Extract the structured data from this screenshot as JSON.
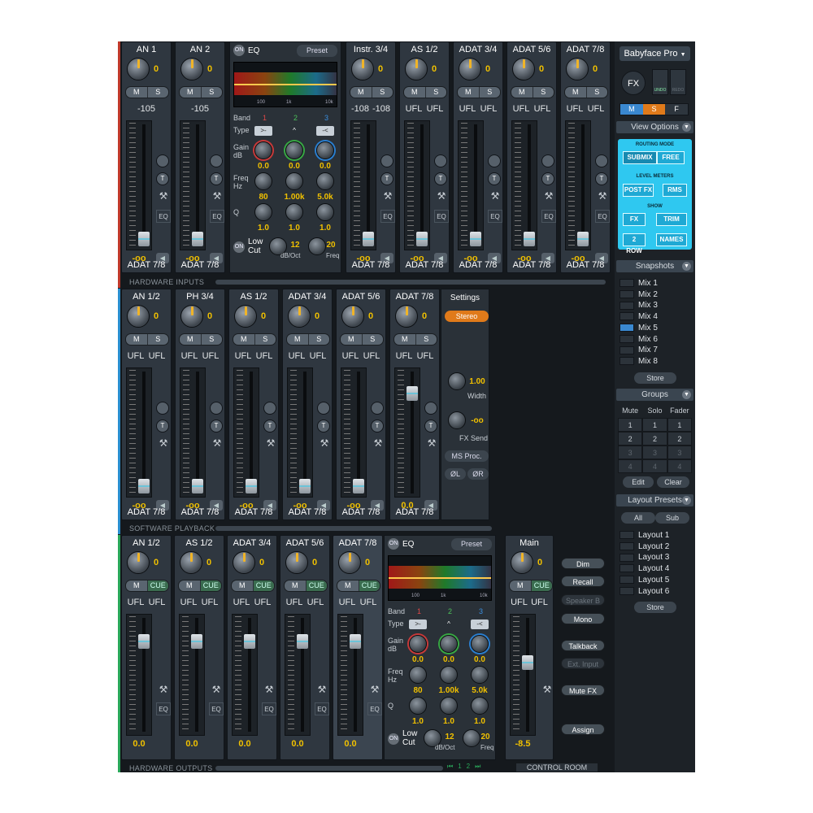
{
  "inputs": {
    "channels": [
      {
        "name": "AN 1",
        "gain": "0",
        "level": "-105",
        "route": "ADAT 7/8",
        "fader": "-oo"
      },
      {
        "name": "AN 2",
        "gain": "0",
        "level": "-105",
        "route": "ADAT 7/8",
        "fader": "-oo"
      },
      {
        "name": "Instr. 3/4",
        "gain": "0",
        "level_l": "-108",
        "level_r": "-108",
        "route": "ADAT 7/8",
        "fader": "-oo"
      },
      {
        "name": "AS 1/2",
        "gain": "0",
        "level_l": "UFL",
        "level_r": "UFL",
        "route": "ADAT 7/8",
        "fader": "-oo"
      },
      {
        "name": "ADAT 3/4",
        "gain": "0",
        "level_l": "UFL",
        "level_r": "UFL",
        "route": "ADAT 7/8",
        "fader": "-oo"
      },
      {
        "name": "ADAT 5/6",
        "gain": "0",
        "level_l": "UFL",
        "level_r": "UFL",
        "route": "ADAT 7/8",
        "fader": "-oo"
      },
      {
        "name": "ADAT 7/8",
        "gain": "0",
        "level_l": "UFL",
        "level_r": "UFL",
        "route": "ADAT 7/8",
        "fader": "-oo"
      }
    ],
    "section_label": "HARDWARE INPUTS"
  },
  "eq": {
    "power": "ON",
    "title": "EQ",
    "preset": "Preset",
    "graph_labels": [
      "100",
      "1k",
      "10k"
    ],
    "band_label": "Band",
    "bands": [
      "1",
      "2",
      "3"
    ],
    "type_label": "Type",
    "types": [
      ">-",
      "^",
      "-<"
    ],
    "gain_label": "Gain",
    "gain_unit": "dB",
    "gain_values": [
      "0.0",
      "0.0",
      "0.0"
    ],
    "freq_label": "Freq",
    "freq_unit": "Hz",
    "freq_values": [
      "80",
      "1.00k",
      "5.0k"
    ],
    "q_label": "Q",
    "q_values": [
      "1.0",
      "1.0",
      "1.0"
    ],
    "lowcut_label": "Low Cut",
    "lowcut_slope": "12",
    "lowcut_slope_unit": "dB/Oct",
    "lowcut_freq": "20",
    "lowcut_freq_unit": "Freq"
  },
  "playback": {
    "channels": [
      {
        "name": "AN 1/2",
        "gain": "0",
        "route": "ADAT 7/8",
        "fader": "-oo"
      },
      {
        "name": "PH 3/4",
        "gain": "0",
        "route": "ADAT 7/8",
        "fader": "-oo"
      },
      {
        "name": "AS 1/2",
        "gain": "0",
        "route": "ADAT 7/8",
        "fader": "-oo"
      },
      {
        "name": "ADAT 3/4",
        "gain": "0",
        "route": "ADAT 7/8",
        "fader": "-oo"
      },
      {
        "name": "ADAT 5/6",
        "gain": "0",
        "route": "ADAT 7/8",
        "fader": "-oo"
      },
      {
        "name": "ADAT 7/8",
        "gain": "0",
        "route": "ADAT 7/8",
        "fader": "0.0"
      }
    ],
    "level_l": "UFL",
    "level_r": "UFL",
    "settings": {
      "title": "Settings",
      "mode": "Stereo",
      "width_value": "1.00",
      "width_label": "Width",
      "fxsend_value": "-oo",
      "fxsend_label": "FX Send",
      "ms_proc": "MS Proc.",
      "phase_l": "ØL",
      "phase_r": "ØR"
    },
    "section_label": "SOFTWARE PLAYBACK"
  },
  "outputs": {
    "channels": [
      {
        "name": "AN 1/2",
        "gain": "0",
        "fader": "0.0"
      },
      {
        "name": "AS 1/2",
        "gain": "0",
        "fader": "0.0"
      },
      {
        "name": "ADAT 3/4",
        "gain": "0",
        "fader": "0.0"
      },
      {
        "name": "ADAT 5/6",
        "gain": "0",
        "fader": "0.0"
      },
      {
        "name": "ADAT 7/8",
        "gain": "0",
        "fader": "0.0"
      }
    ],
    "level_l": "UFL",
    "level_r": "UFL",
    "mute_label": "M",
    "cue_label": "CUE",
    "main": {
      "name": "Main",
      "gain": "0",
      "fader": "-8.5"
    },
    "control_buttons": [
      "Dim",
      "Recall",
      "Speaker B",
      "Mono",
      "Talkback",
      "Ext. Input",
      "Mute FX",
      "Assign"
    ],
    "section_label": "HARDWARE OUTPUTS",
    "control_room_label": "CONTROL ROOM",
    "pages": [
      "1",
      "2"
    ]
  },
  "sidebar": {
    "device": "Babyface Pro",
    "fx_label": "FX",
    "undo": "UNDO",
    "redo": "REDO",
    "ms_buttons": [
      "M",
      "S",
      "F"
    ],
    "view_options": "View Options",
    "routing_mode_label": "ROUTING MODE",
    "submix": "SUBMIX",
    "free": "FREE",
    "level_meters_label": "LEVEL METERS",
    "post_fx": "POST FX",
    "rms": "RMS",
    "show_label": "SHOW",
    "fx": "FX",
    "trim": "TRIM",
    "two_row": "2 ROW",
    "names": "NAMES",
    "snapshots_label": "Snapshots",
    "snapshots": [
      "Mix 1",
      "Mix 2",
      "Mix 3",
      "Mix 4",
      "Mix 5",
      "Mix 6",
      "Mix 7",
      "Mix 8"
    ],
    "active_snapshot": 4,
    "store": "Store",
    "groups_label": "Groups",
    "group_headers": [
      "Mute",
      "Solo",
      "Fader"
    ],
    "edit": "Edit",
    "clear": "Clear",
    "layout_presets_label": "Layout Presets",
    "all": "All",
    "sub": "Sub",
    "layouts": [
      "Layout 1",
      "Layout 2",
      "Layout 3",
      "Layout 4",
      "Layout 5",
      "Layout 6"
    ]
  },
  "colors": {
    "accent_inputs": "#c0392b",
    "accent_playback": "#2a8fd0",
    "accent_outputs": "#2aa85a",
    "value_yellow": "#f0c000",
    "panel_cyan": "#2fc8f0"
  }
}
